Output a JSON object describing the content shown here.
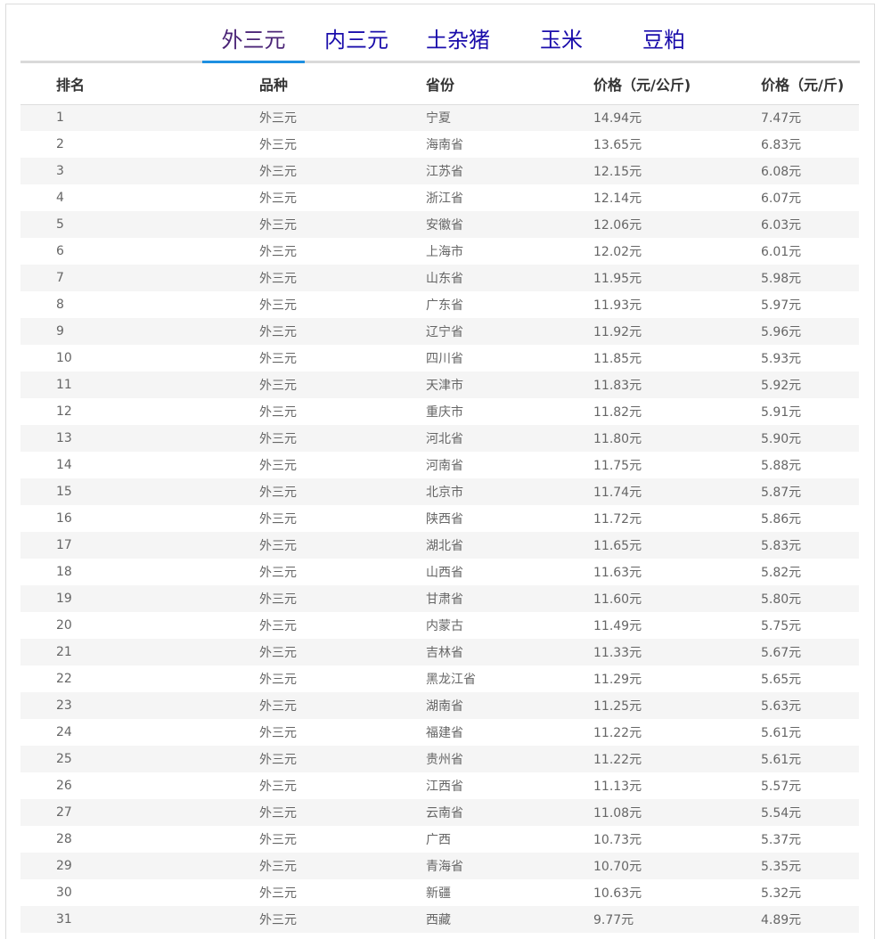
{
  "tabs": [
    {
      "label": "外三元",
      "active": true
    },
    {
      "label": "内三元",
      "active": false
    },
    {
      "label": "土杂猪",
      "active": false
    },
    {
      "label": "玉米",
      "active": false
    },
    {
      "label": "豆粕",
      "active": false
    }
  ],
  "table": {
    "headers": [
      "排名",
      "品种",
      "省份",
      "价格（元/公斤)",
      "价格（元/斤)"
    ],
    "rows": [
      [
        "1",
        "外三元",
        "宁夏",
        "14.94元",
        "7.47元"
      ],
      [
        "2",
        "外三元",
        "海南省",
        "13.65元",
        "6.83元"
      ],
      [
        "3",
        "外三元",
        "江苏省",
        "12.15元",
        "6.08元"
      ],
      [
        "4",
        "外三元",
        "浙江省",
        "12.14元",
        "6.07元"
      ],
      [
        "5",
        "外三元",
        "安徽省",
        "12.06元",
        "6.03元"
      ],
      [
        "6",
        "外三元",
        "上海市",
        "12.02元",
        "6.01元"
      ],
      [
        "7",
        "外三元",
        "山东省",
        "11.95元",
        "5.98元"
      ],
      [
        "8",
        "外三元",
        "广东省",
        "11.93元",
        "5.97元"
      ],
      [
        "9",
        "外三元",
        "辽宁省",
        "11.92元",
        "5.96元"
      ],
      [
        "10",
        "外三元",
        "四川省",
        "11.85元",
        "5.93元"
      ],
      [
        "11",
        "外三元",
        "天津市",
        "11.83元",
        "5.92元"
      ],
      [
        "12",
        "外三元",
        "重庆市",
        "11.82元",
        "5.91元"
      ],
      [
        "13",
        "外三元",
        "河北省",
        "11.80元",
        "5.90元"
      ],
      [
        "14",
        "外三元",
        "河南省",
        "11.75元",
        "5.88元"
      ],
      [
        "15",
        "外三元",
        "北京市",
        "11.74元",
        "5.87元"
      ],
      [
        "16",
        "外三元",
        "陕西省",
        "11.72元",
        "5.86元"
      ],
      [
        "17",
        "外三元",
        "湖北省",
        "11.65元",
        "5.83元"
      ],
      [
        "18",
        "外三元",
        "山西省",
        "11.63元",
        "5.82元"
      ],
      [
        "19",
        "外三元",
        "甘肃省",
        "11.60元",
        "5.80元"
      ],
      [
        "20",
        "外三元",
        "内蒙古",
        "11.49元",
        "5.75元"
      ],
      [
        "21",
        "外三元",
        "吉林省",
        "11.33元",
        "5.67元"
      ],
      [
        "22",
        "外三元",
        "黑龙江省",
        "11.29元",
        "5.65元"
      ],
      [
        "23",
        "外三元",
        "湖南省",
        "11.25元",
        "5.63元"
      ],
      [
        "24",
        "外三元",
        "福建省",
        "11.22元",
        "5.61元"
      ],
      [
        "25",
        "外三元",
        "贵州省",
        "11.22元",
        "5.61元"
      ],
      [
        "26",
        "外三元",
        "江西省",
        "11.13元",
        "5.57元"
      ],
      [
        "27",
        "外三元",
        "云南省",
        "11.08元",
        "5.54元"
      ],
      [
        "28",
        "外三元",
        "广西",
        "10.73元",
        "5.37元"
      ],
      [
        "29",
        "外三元",
        "青海省",
        "10.70元",
        "5.35元"
      ],
      [
        "30",
        "外三元",
        "新疆",
        "10.63元",
        "5.32元"
      ],
      [
        "31",
        "外三元",
        "西藏",
        "9.77元",
        "4.89元"
      ]
    ]
  },
  "colors": {
    "tab_link": "#1a0dab",
    "tab_active": "#4b2577",
    "tab_underline": "#1e8fe1",
    "row_stripe": "#f5f5f5"
  }
}
